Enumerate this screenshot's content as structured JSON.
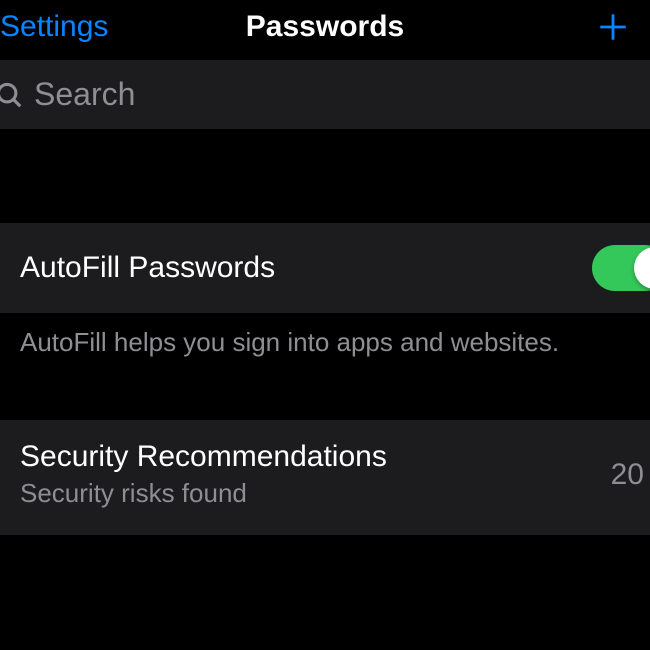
{
  "nav": {
    "back_label": "Settings",
    "title": "Passwords"
  },
  "search": {
    "placeholder": "Search"
  },
  "autofill": {
    "label": "AutoFill Passwords",
    "footer": "AutoFill helps you sign into apps and websites.",
    "enabled": true
  },
  "security": {
    "title": "Security Recommendations",
    "subtitle": "Security risks found",
    "count": "20"
  }
}
